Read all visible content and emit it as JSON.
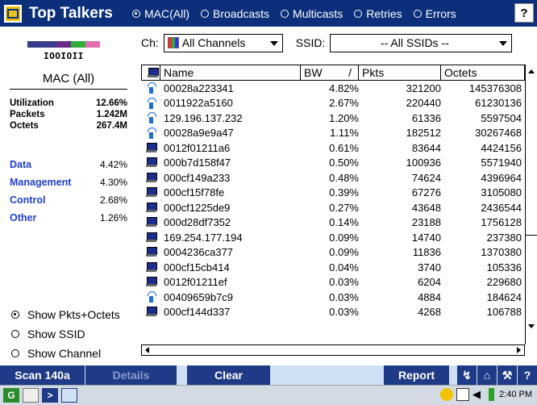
{
  "title": "Top Talkers",
  "view_modes": [
    {
      "label": "MAC(All)",
      "selected": true
    },
    {
      "label": "Broadcasts",
      "selected": false
    },
    {
      "label": "Multicasts",
      "selected": false
    },
    {
      "label": "Retries",
      "selected": false
    },
    {
      "label": "Errors",
      "selected": false
    }
  ],
  "help_label": "?",
  "left": {
    "logo_text": "IOOIOII",
    "section_title": "MAC (All)",
    "stats": [
      {
        "label": "Utilization",
        "value": "12.66%"
      },
      {
        "label": "Packets",
        "value": "1.242M"
      },
      {
        "label": "Octets",
        "value": "267.4M"
      }
    ],
    "categories": [
      {
        "label": "Data",
        "value": "4.42%"
      },
      {
        "label": "Management",
        "value": "4.30%"
      },
      {
        "label": "Control",
        "value": "2.68%"
      },
      {
        "label": "Other",
        "value": "1.26%"
      }
    ],
    "display_options": [
      {
        "label": "Show Pkts+Octets",
        "selected": true
      },
      {
        "label": "Show SSID",
        "selected": false
      },
      {
        "label": "Show Channel",
        "selected": false
      }
    ]
  },
  "filters": {
    "channel_label": "Ch:",
    "channel_value": "All Channels",
    "ssid_label": "SSID:",
    "ssid_value": "-- All SSIDs --"
  },
  "table": {
    "columns": {
      "name": "Name",
      "bw": "BW",
      "bw_sort": "/",
      "pkts": "Pkts",
      "octets": "Octets"
    },
    "rows": [
      {
        "type": "ap",
        "name": "00028a223341",
        "bw": "4.82%",
        "pkts": "321200",
        "octets": "145376308"
      },
      {
        "type": "ap",
        "name": "0011922a5160",
        "bw": "2.67%",
        "pkts": "220440",
        "octets": "61230136"
      },
      {
        "type": "ap",
        "name": "129.196.137.232",
        "bw": "1.20%",
        "pkts": "61336",
        "octets": "5597504"
      },
      {
        "type": "ap",
        "name": "00028a9e9a47",
        "bw": "1.11%",
        "pkts": "182512",
        "octets": "30267468"
      },
      {
        "type": "pc",
        "name": "0012f01211a6",
        "bw": "0.61%",
        "pkts": "83644",
        "octets": "4424156"
      },
      {
        "type": "pc",
        "name": "000b7d158f47",
        "bw": "0.50%",
        "pkts": "100936",
        "octets": "5571940"
      },
      {
        "type": "pc",
        "name": "000cf149a233",
        "bw": "0.48%",
        "pkts": "74624",
        "octets": "4396964"
      },
      {
        "type": "pc",
        "name": "000cf15f78fe",
        "bw": "0.39%",
        "pkts": "67276",
        "octets": "3105080"
      },
      {
        "type": "pc",
        "name": "000cf1225de9",
        "bw": "0.27%",
        "pkts": "43648",
        "octets": "2436544"
      },
      {
        "type": "pc",
        "name": "000d28df7352",
        "bw": "0.14%",
        "pkts": "23188",
        "octets": "1756128"
      },
      {
        "type": "pc",
        "name": "169.254.177.194",
        "bw": "0.09%",
        "pkts": "14740",
        "octets": "237380"
      },
      {
        "type": "pc",
        "name": "0004236ca377",
        "bw": "0.09%",
        "pkts": "11836",
        "octets": "1370380"
      },
      {
        "type": "pc",
        "name": "000cf15cb414",
        "bw": "0.04%",
        "pkts": "3740",
        "octets": "105336"
      },
      {
        "type": "pc",
        "name": "0012f01211ef",
        "bw": "0.03%",
        "pkts": "6204",
        "octets": "229680"
      },
      {
        "type": "ap",
        "name": "00409659b7c9",
        "bw": "0.03%",
        "pkts": "4884",
        "octets": "184624"
      },
      {
        "type": "pc",
        "name": "000cf144d337",
        "bw": "0.03%",
        "pkts": "4268",
        "octets": "106788"
      }
    ]
  },
  "toolbar": {
    "scan_label": "Scan 140a",
    "details_label": "Details",
    "clear_label": "Clear",
    "report_label": "Report"
  },
  "taskbar": {
    "clock": "2:40 PM"
  },
  "colors": {
    "titlebar": "#0c2f7b",
    "accent_blue": "#1f3fd0",
    "toolbar_button": "#1f3a86",
    "toolbar_bg": "#cfe0f5"
  }
}
